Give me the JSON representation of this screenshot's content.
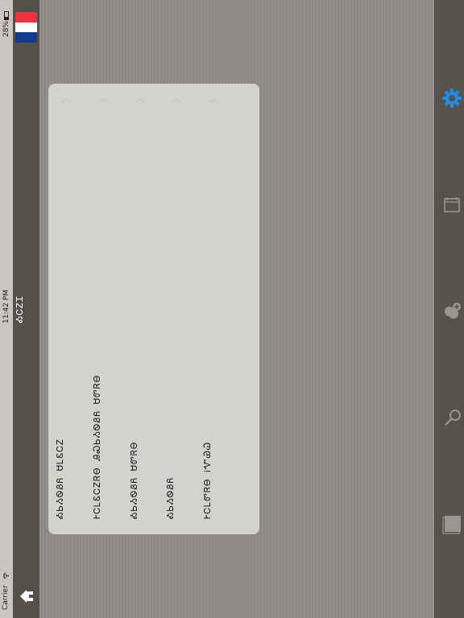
{
  "status_bar": {
    "carrier": "Carrier",
    "time": "11:42 PM",
    "battery": "28%"
  },
  "nav_bar": {
    "title": "ᎣᏟᏃᏆ",
    "language_flag": "french-flag-icon",
    "home_icon": "home-icon"
  },
  "menu": {
    "items": [
      {
        "label": "ᎣᏏᏱᏫᏰᏲ ᏌᏞᏋᏟᏃ"
      },
      {
        "label": "ᎨᏟᏞᏋᏟᏃᏒᎾ ᎯᏍᏏᏱᏫᏰᏲ ᏌᏛᏒᎾ"
      },
      {
        "label": "ᎣᏏᏱᏫᏰᏲ ᏌᏛᏒᎾ"
      },
      {
        "label": "ᎣᏏᏱᏫᏰᏲ"
      },
      {
        "label": "ᎨᏟᏞᏛᏒᎾ ᎥᏉᏯᏇ"
      }
    ]
  },
  "tab_bar": {
    "items": [
      {
        "icon": "gear-icon",
        "active": true
      },
      {
        "icon": "notepad-icon",
        "active": false
      },
      {
        "icon": "add-group-icon",
        "active": false
      },
      {
        "icon": "search-icon",
        "active": false
      },
      {
        "icon": "book-icon",
        "active": false
      }
    ]
  },
  "colors": {
    "accent": "#1a8fe8",
    "nav_bar": "#55504a",
    "card": "#d4d2cf",
    "background": "#8f8b86"
  }
}
